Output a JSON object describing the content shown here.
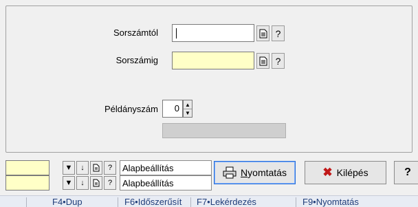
{
  "form": {
    "from_label": "Sorszámtól",
    "to_label": "Sorszámig",
    "copies_label": "Példányszám",
    "from_value": "",
    "to_value": "",
    "copies_value": "0",
    "progress": 0
  },
  "icons": {
    "document": "document-icon",
    "help": "?",
    "down": "▼",
    "arrow_down": "↓",
    "printer": "printer-icon",
    "close": "✖"
  },
  "filters": [
    {
      "preset_label": "Alapbeállítás"
    },
    {
      "preset_label": "Alapbeállítás"
    }
  ],
  "buttons": {
    "print_label_underlined": "N",
    "print_label_rest": "yomtatás",
    "exit_label": "Kilépés",
    "help_label": "?"
  },
  "fkeys": [
    "F4•Dup",
    "F6•Időszerűsít",
    "F7•Lekérdezés",
    "F9•Nyomtatás"
  ],
  "colors": {
    "field_yellow": "#ffffc7",
    "window_bg": "#f0f0f0",
    "exit_icon": "#c01818",
    "fkey_text": "#1f3d7a"
  }
}
